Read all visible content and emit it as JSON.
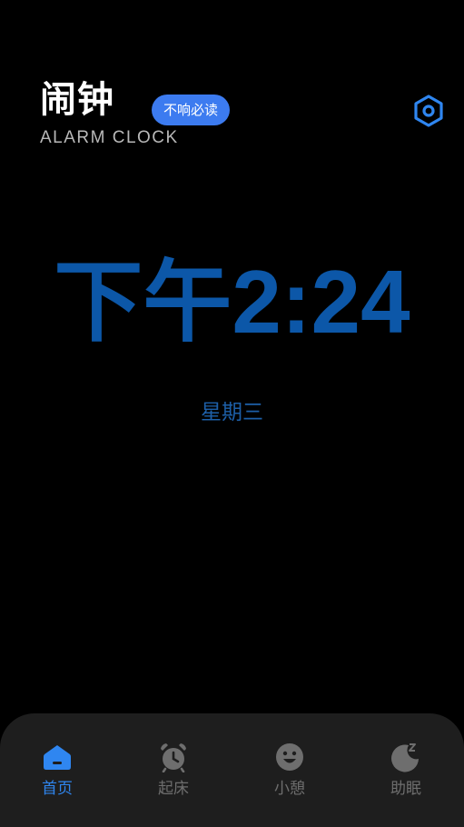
{
  "header": {
    "title": "闹钟",
    "subtitle": "ALARM CLOCK",
    "badge": "不响必读",
    "settings_icon": "settings-hexagon-icon"
  },
  "clock": {
    "time": "下午2:24",
    "weekday": "星期三"
  },
  "tabs": [
    {
      "label": "首页",
      "icon": "home-icon",
      "active": true
    },
    {
      "label": "起床",
      "icon": "alarm-icon",
      "active": false
    },
    {
      "label": "小憩",
      "icon": "smile-icon",
      "active": false
    },
    {
      "label": "助眠",
      "icon": "moon-sleep-icon",
      "active": false
    }
  ],
  "colors": {
    "background": "#000000",
    "accent": "#2f86f0",
    "badge": "#3c7bf0",
    "clock": "#0c57a8",
    "tabbar": "#1e1e1e",
    "inactive": "#6e6e6e"
  }
}
